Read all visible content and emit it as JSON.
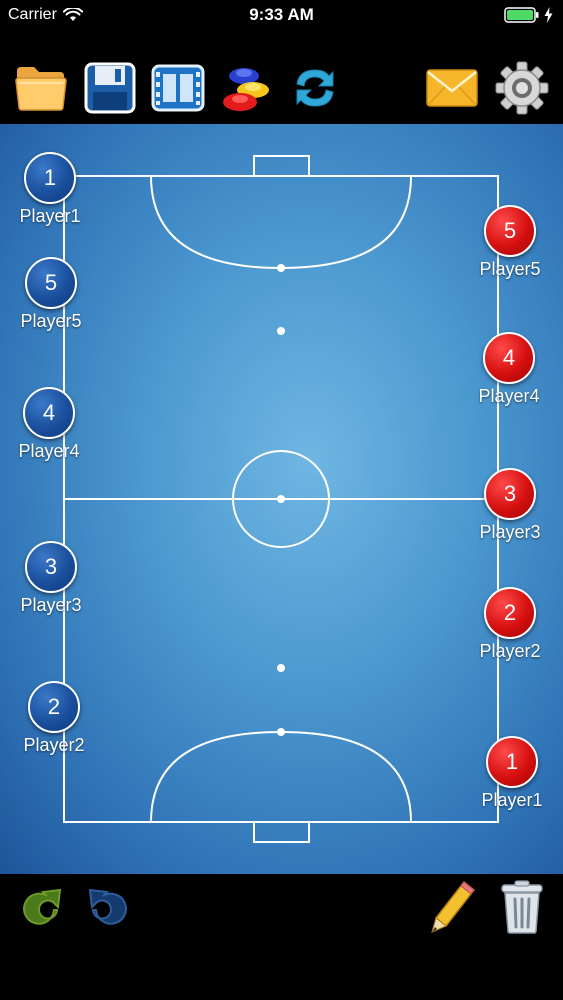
{
  "status_bar": {
    "carrier": "Carrier",
    "time": "9:33 AM"
  },
  "toolbar": {
    "icons": [
      "folder-icon",
      "save-disk-icon",
      "film-icon",
      "cones-icon",
      "swap-arrows-icon",
      "mail-icon",
      "gear-icon"
    ]
  },
  "colors": {
    "team_blue": "#1a4f9c",
    "team_red": "#d50f0f",
    "field_blue": "#4e9bd2",
    "line_white": "#ffffff"
  },
  "blue_team": [
    {
      "number": "1",
      "label": "Player1"
    },
    {
      "number": "5",
      "label": "Player5"
    },
    {
      "number": "4",
      "label": "Player4"
    },
    {
      "number": "3",
      "label": "Player3"
    },
    {
      "number": "2",
      "label": "Player2"
    }
  ],
  "red_team": [
    {
      "number": "5",
      "label": "Player5"
    },
    {
      "number": "4",
      "label": "Player4"
    },
    {
      "number": "3",
      "label": "Player3"
    },
    {
      "number": "2",
      "label": "Player2"
    },
    {
      "number": "1",
      "label": "Player1"
    }
  ],
  "bottom_toolbar": {
    "icons": [
      "redo-icon",
      "undo-icon",
      "pencil-icon",
      "trash-icon"
    ]
  }
}
